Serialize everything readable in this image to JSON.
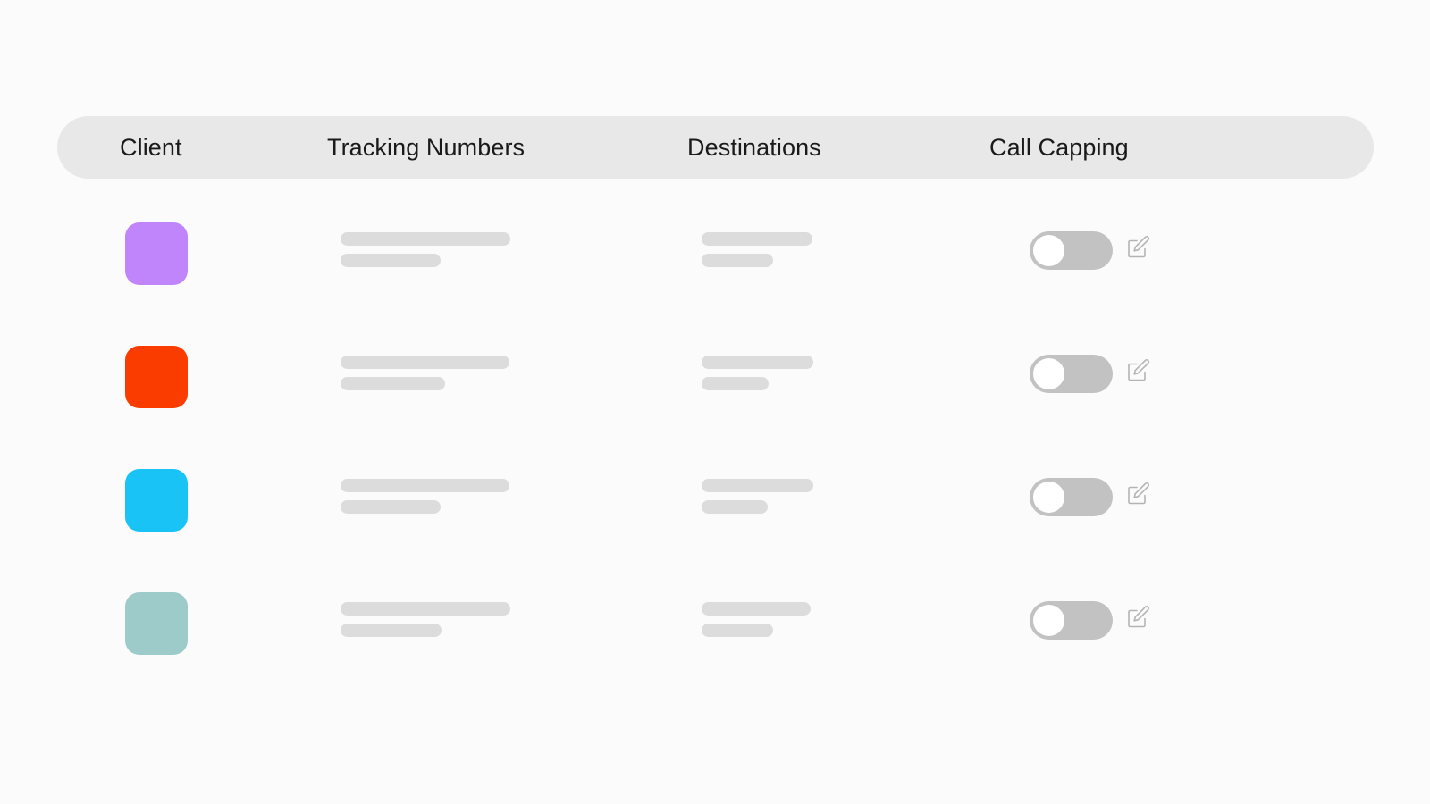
{
  "table": {
    "columns": [
      {
        "key": "client",
        "label": "Client"
      },
      {
        "key": "tracking",
        "label": "Tracking Numbers"
      },
      {
        "key": "destinations",
        "label": "Destinations"
      },
      {
        "key": "capping",
        "label": "Call Capping"
      }
    ],
    "rows": [
      {
        "client_swatch_color": "#c084fb",
        "tracking_placeholders": [
          190,
          112
        ],
        "destination_placeholders": [
          124,
          80
        ],
        "call_capping_enabled": false,
        "edit_icon": "edit-pencil-icon"
      },
      {
        "client_swatch_color": "#fa3c00",
        "tracking_placeholders": [
          189,
          117
        ],
        "destination_placeholders": [
          125,
          75
        ],
        "call_capping_enabled": false,
        "edit_icon": "edit-pencil-icon"
      },
      {
        "client_swatch_color": "#1ac3f5",
        "tracking_placeholders": [
          189,
          112
        ],
        "destination_placeholders": [
          125,
          74
        ],
        "call_capping_enabled": false,
        "edit_icon": "edit-pencil-icon"
      },
      {
        "client_swatch_color": "#9ccbc9",
        "tracking_placeholders": [
          190,
          113
        ],
        "destination_placeholders": [
          122,
          80
        ],
        "call_capping_enabled": false,
        "edit_icon": "edit-pencil-icon"
      }
    ]
  },
  "colors": {
    "page_background": "#fbfbfb",
    "header_background": "#e8e8e8",
    "header_text": "#1a1a1a",
    "skeleton": "#dcdcdc",
    "toggle_track_off": "#c2c2c2",
    "toggle_knob": "#ffffff",
    "edit_icon_stroke": "#b4b4b4"
  }
}
